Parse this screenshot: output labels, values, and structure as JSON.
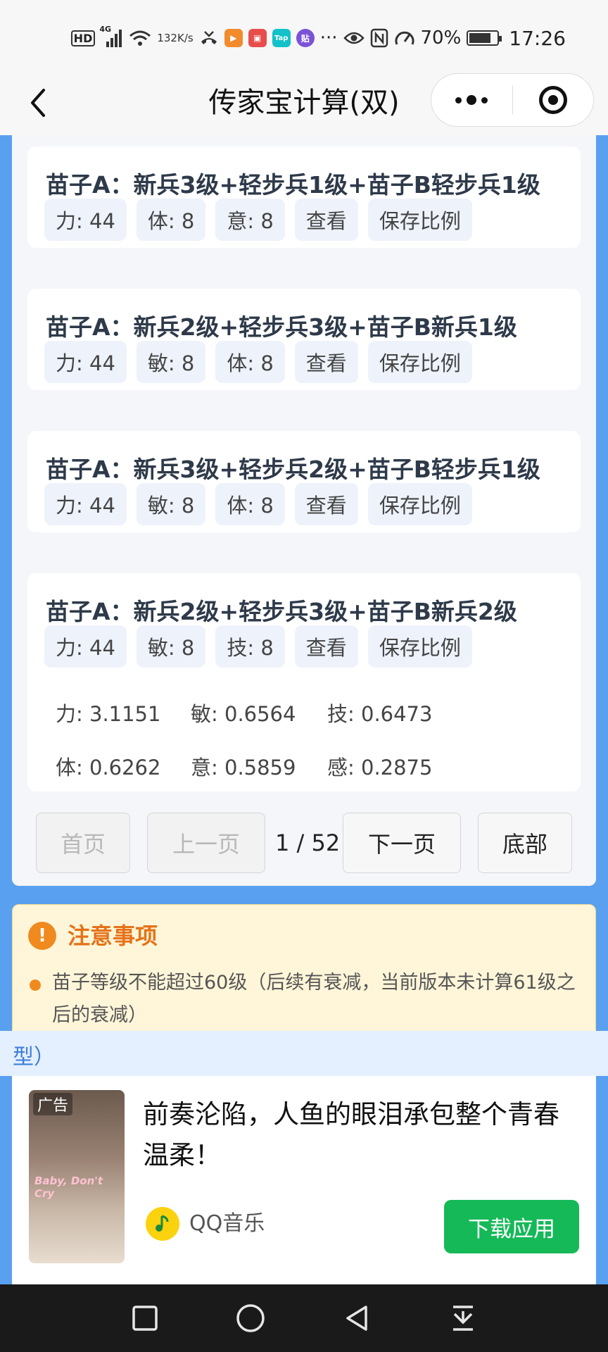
{
  "status_bar": {
    "hd": "HD",
    "net_gen": "4G",
    "speed_value": "132",
    "speed_unit": "K/s",
    "more": "···",
    "battery": "70%",
    "time": "17:26",
    "app_icon_colors": [
      "#f28b2c",
      "#e84c4c",
      "#12c2c8",
      "#7a53d6"
    ]
  },
  "nav": {
    "title": "传家宝计算(双)"
  },
  "cards": [
    {
      "title": "苗子A：新兵3级+轻步兵1级+苗子B轻步兵1级",
      "chips": [
        "力: 44",
        "体: 8",
        "意: 8",
        "查看",
        "保存比例"
      ]
    },
    {
      "title": "苗子A：新兵2级+轻步兵3级+苗子B新兵1级",
      "chips": [
        "力: 44",
        "敏: 8",
        "体: 8",
        "查看",
        "保存比例"
      ]
    },
    {
      "title": "苗子A：新兵3级+轻步兵2级+苗子B轻步兵1级",
      "chips": [
        "力: 44",
        "敏: 8",
        "体: 8",
        "查看",
        "保存比例"
      ]
    },
    {
      "title": "苗子A：新兵2级+轻步兵3级+苗子B新兵2级",
      "chips": [
        "力: 44",
        "敏: 8",
        "技: 8",
        "查看",
        "保存比例"
      ],
      "ratios": [
        [
          "力: 3.1151",
          "敏: 0.6564",
          "技: 0.6473"
        ],
        [
          "体: 0.6262",
          "意: 0.5859",
          "感: 0.2875"
        ]
      ]
    }
  ],
  "pager": {
    "first": "首页",
    "prev": "上一页",
    "page_indicator": "1 / 52",
    "next": "下一页",
    "bottom": "底部"
  },
  "notice": {
    "icon": "!",
    "title": "注意事项",
    "item": "苗子等级不能超过60级（后续有衰减，当前版本未计算61级之后的衰减）"
  },
  "strip": {
    "text": "型）"
  },
  "ad": {
    "label": "广告",
    "image_text": "Baby, Don't Cry",
    "title": "前奏沦陷，人鱼的眼泪承包整个青春温柔！",
    "app_name": "QQ音乐",
    "button": "下载应用"
  },
  "colors": {
    "page_bg": "#5aa0f0",
    "accent_orange": "#e5731a",
    "download_green": "#16b958"
  }
}
